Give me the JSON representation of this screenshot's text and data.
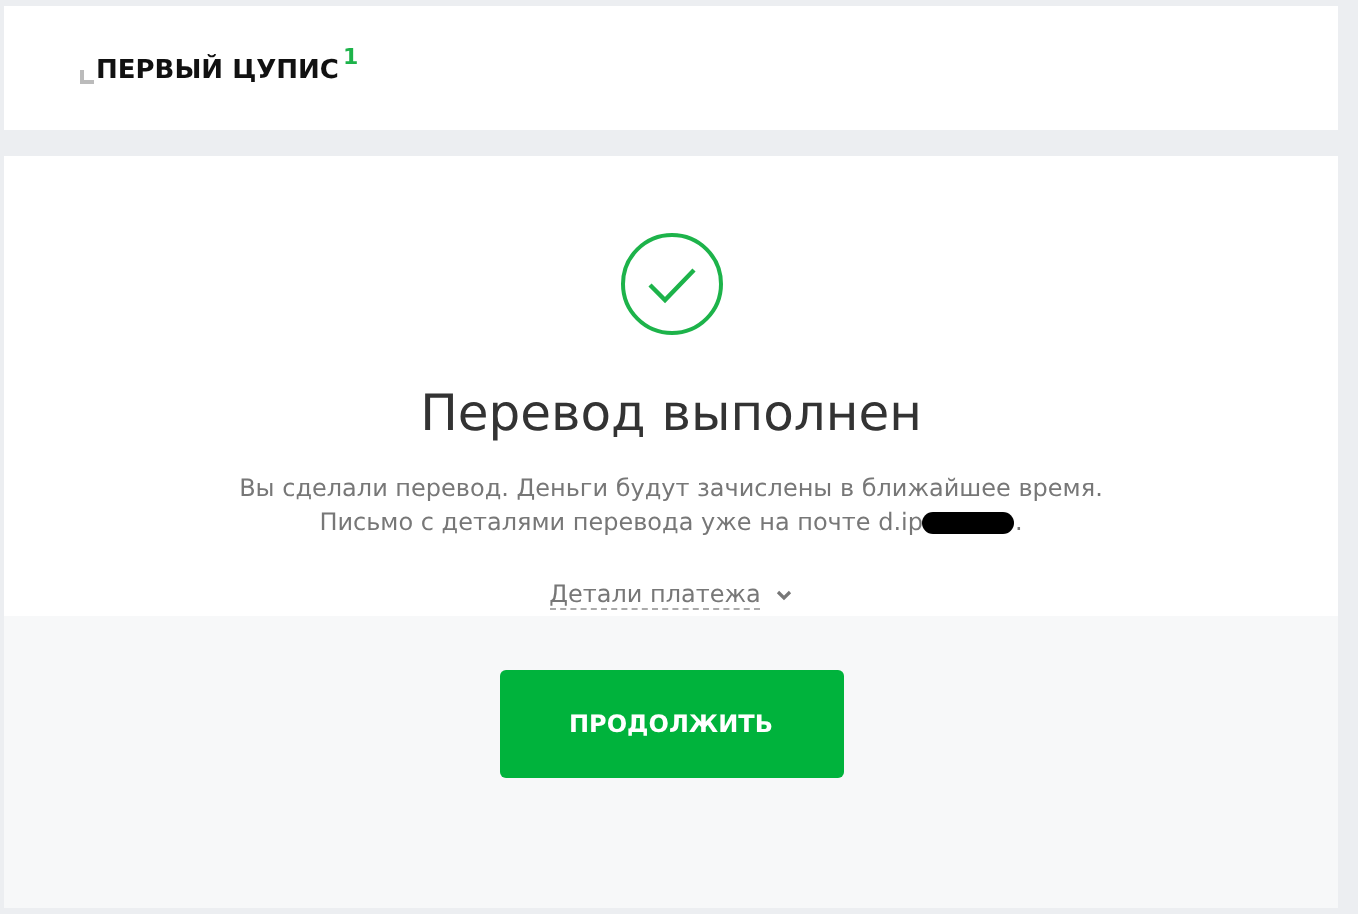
{
  "header": {
    "logo": "ПЕРВЫЙ ЦУПИС",
    "logo_mark": "1"
  },
  "result": {
    "title": "Перевод выполнен",
    "message": "Вы сделали перевод. Деньги будут зачислены в ближайшее время.",
    "email_line": "Письмо с деталями перевода уже на почте d.ip",
    "email_end": ".",
    "details_link": "Детали платежа",
    "expanded": false
  },
  "button": "ПРОДОЛЖИТЬ"
}
